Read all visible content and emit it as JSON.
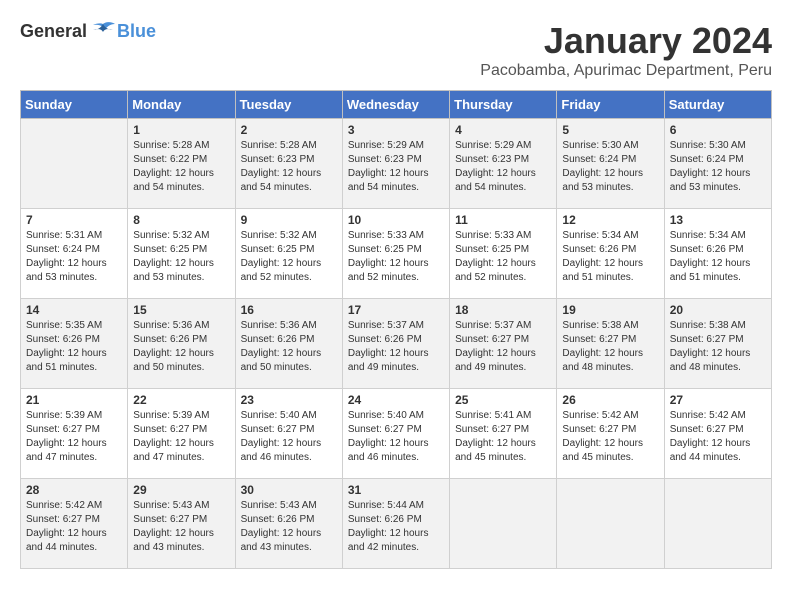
{
  "logo": {
    "general": "General",
    "blue": "Blue"
  },
  "title": "January 2024",
  "location": "Pacobamba, Apurimac Department, Peru",
  "weekdays": [
    "Sunday",
    "Monday",
    "Tuesday",
    "Wednesday",
    "Thursday",
    "Friday",
    "Saturday"
  ],
  "weeks": [
    [
      {
        "day": "",
        "sunrise": "",
        "sunset": "",
        "daylight": ""
      },
      {
        "day": "1",
        "sunrise": "Sunrise: 5:28 AM",
        "sunset": "Sunset: 6:22 PM",
        "daylight": "Daylight: 12 hours and 54 minutes."
      },
      {
        "day": "2",
        "sunrise": "Sunrise: 5:28 AM",
        "sunset": "Sunset: 6:23 PM",
        "daylight": "Daylight: 12 hours and 54 minutes."
      },
      {
        "day": "3",
        "sunrise": "Sunrise: 5:29 AM",
        "sunset": "Sunset: 6:23 PM",
        "daylight": "Daylight: 12 hours and 54 minutes."
      },
      {
        "day": "4",
        "sunrise": "Sunrise: 5:29 AM",
        "sunset": "Sunset: 6:23 PM",
        "daylight": "Daylight: 12 hours and 54 minutes."
      },
      {
        "day": "5",
        "sunrise": "Sunrise: 5:30 AM",
        "sunset": "Sunset: 6:24 PM",
        "daylight": "Daylight: 12 hours and 53 minutes."
      },
      {
        "day": "6",
        "sunrise": "Sunrise: 5:30 AM",
        "sunset": "Sunset: 6:24 PM",
        "daylight": "Daylight: 12 hours and 53 minutes."
      }
    ],
    [
      {
        "day": "7",
        "sunrise": "Sunrise: 5:31 AM",
        "sunset": "Sunset: 6:24 PM",
        "daylight": "Daylight: 12 hours and 53 minutes."
      },
      {
        "day": "8",
        "sunrise": "Sunrise: 5:32 AM",
        "sunset": "Sunset: 6:25 PM",
        "daylight": "Daylight: 12 hours and 53 minutes."
      },
      {
        "day": "9",
        "sunrise": "Sunrise: 5:32 AM",
        "sunset": "Sunset: 6:25 PM",
        "daylight": "Daylight: 12 hours and 52 minutes."
      },
      {
        "day": "10",
        "sunrise": "Sunrise: 5:33 AM",
        "sunset": "Sunset: 6:25 PM",
        "daylight": "Daylight: 12 hours and 52 minutes."
      },
      {
        "day": "11",
        "sunrise": "Sunrise: 5:33 AM",
        "sunset": "Sunset: 6:25 PM",
        "daylight": "Daylight: 12 hours and 52 minutes."
      },
      {
        "day": "12",
        "sunrise": "Sunrise: 5:34 AM",
        "sunset": "Sunset: 6:26 PM",
        "daylight": "Daylight: 12 hours and 51 minutes."
      },
      {
        "day": "13",
        "sunrise": "Sunrise: 5:34 AM",
        "sunset": "Sunset: 6:26 PM",
        "daylight": "Daylight: 12 hours and 51 minutes."
      }
    ],
    [
      {
        "day": "14",
        "sunrise": "Sunrise: 5:35 AM",
        "sunset": "Sunset: 6:26 PM",
        "daylight": "Daylight: 12 hours and 51 minutes."
      },
      {
        "day": "15",
        "sunrise": "Sunrise: 5:36 AM",
        "sunset": "Sunset: 6:26 PM",
        "daylight": "Daylight: 12 hours and 50 minutes."
      },
      {
        "day": "16",
        "sunrise": "Sunrise: 5:36 AM",
        "sunset": "Sunset: 6:26 PM",
        "daylight": "Daylight: 12 hours and 50 minutes."
      },
      {
        "day": "17",
        "sunrise": "Sunrise: 5:37 AM",
        "sunset": "Sunset: 6:26 PM",
        "daylight": "Daylight: 12 hours and 49 minutes."
      },
      {
        "day": "18",
        "sunrise": "Sunrise: 5:37 AM",
        "sunset": "Sunset: 6:27 PM",
        "daylight": "Daylight: 12 hours and 49 minutes."
      },
      {
        "day": "19",
        "sunrise": "Sunrise: 5:38 AM",
        "sunset": "Sunset: 6:27 PM",
        "daylight": "Daylight: 12 hours and 48 minutes."
      },
      {
        "day": "20",
        "sunrise": "Sunrise: 5:38 AM",
        "sunset": "Sunset: 6:27 PM",
        "daylight": "Daylight: 12 hours and 48 minutes."
      }
    ],
    [
      {
        "day": "21",
        "sunrise": "Sunrise: 5:39 AM",
        "sunset": "Sunset: 6:27 PM",
        "daylight": "Daylight: 12 hours and 47 minutes."
      },
      {
        "day": "22",
        "sunrise": "Sunrise: 5:39 AM",
        "sunset": "Sunset: 6:27 PM",
        "daylight": "Daylight: 12 hours and 47 minutes."
      },
      {
        "day": "23",
        "sunrise": "Sunrise: 5:40 AM",
        "sunset": "Sunset: 6:27 PM",
        "daylight": "Daylight: 12 hours and 46 minutes."
      },
      {
        "day": "24",
        "sunrise": "Sunrise: 5:40 AM",
        "sunset": "Sunset: 6:27 PM",
        "daylight": "Daylight: 12 hours and 46 minutes."
      },
      {
        "day": "25",
        "sunrise": "Sunrise: 5:41 AM",
        "sunset": "Sunset: 6:27 PM",
        "daylight": "Daylight: 12 hours and 45 minutes."
      },
      {
        "day": "26",
        "sunrise": "Sunrise: 5:42 AM",
        "sunset": "Sunset: 6:27 PM",
        "daylight": "Daylight: 12 hours and 45 minutes."
      },
      {
        "day": "27",
        "sunrise": "Sunrise: 5:42 AM",
        "sunset": "Sunset: 6:27 PM",
        "daylight": "Daylight: 12 hours and 44 minutes."
      }
    ],
    [
      {
        "day": "28",
        "sunrise": "Sunrise: 5:42 AM",
        "sunset": "Sunset: 6:27 PM",
        "daylight": "Daylight: 12 hours and 44 minutes."
      },
      {
        "day": "29",
        "sunrise": "Sunrise: 5:43 AM",
        "sunset": "Sunset: 6:27 PM",
        "daylight": "Daylight: 12 hours and 43 minutes."
      },
      {
        "day": "30",
        "sunrise": "Sunrise: 5:43 AM",
        "sunset": "Sunset: 6:26 PM",
        "daylight": "Daylight: 12 hours and 43 minutes."
      },
      {
        "day": "31",
        "sunrise": "Sunrise: 5:44 AM",
        "sunset": "Sunset: 6:26 PM",
        "daylight": "Daylight: 12 hours and 42 minutes."
      },
      {
        "day": "",
        "sunrise": "",
        "sunset": "",
        "daylight": ""
      },
      {
        "day": "",
        "sunrise": "",
        "sunset": "",
        "daylight": ""
      },
      {
        "day": "",
        "sunrise": "",
        "sunset": "",
        "daylight": ""
      }
    ]
  ]
}
